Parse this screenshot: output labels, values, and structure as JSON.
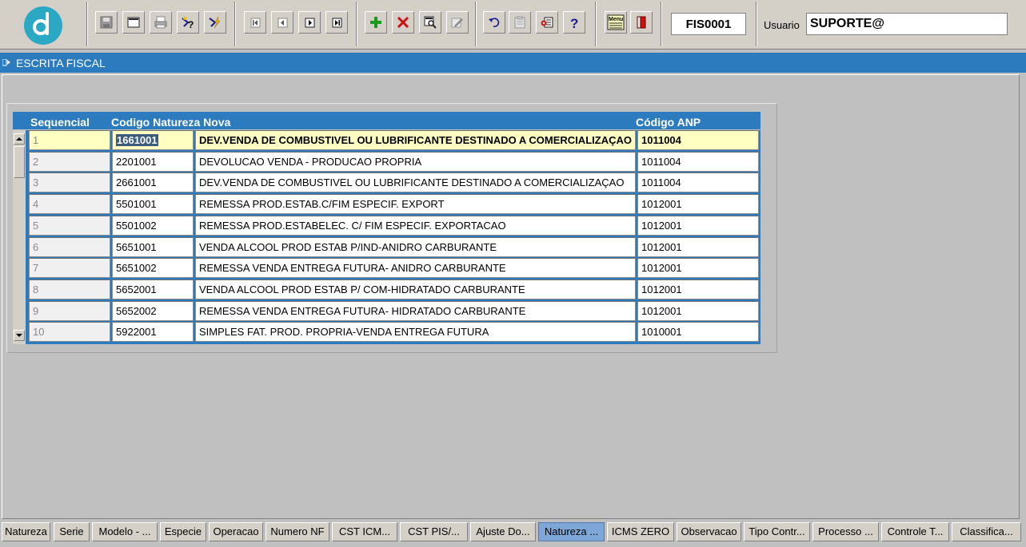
{
  "toolbar": {
    "form_code": "FIS0001",
    "user_label": "Usuario",
    "user_value": "SUPORTE@",
    "menu_icon_text": "Menu"
  },
  "window": {
    "title": "ESCRITA FISCAL"
  },
  "grid": {
    "columns": [
      "Sequencial",
      "Codigo Natureza Nova",
      "Código ANP"
    ],
    "rows": [
      {
        "seq": "1",
        "cod": "1661001",
        "desc": "DEV.VENDA DE COMBUSTIVEL OU LUBRIFICANTE DESTINADO A COMERCIALIZAÇAO",
        "anp": "1011004"
      },
      {
        "seq": "2",
        "cod": "2201001",
        "desc": "DEVOLUCAO VENDA - PRODUCAO PROPRIA",
        "anp": "1011004"
      },
      {
        "seq": "3",
        "cod": "2661001",
        "desc": "DEV.VENDA DE COMBUSTIVEL OU LUBRIFICANTE DESTINADO A COMERCIALIZAÇAO",
        "anp": "1011004"
      },
      {
        "seq": "4",
        "cod": "5501001",
        "desc": "REMESSA PROD.ESTAB.C/FIM ESPECIF. EXPORT",
        "anp": "1012001"
      },
      {
        "seq": "5",
        "cod": "5501002",
        "desc": "REMESSA PROD.ESTABELEC. C/ FIM ESPECIF. EXPORTACAO",
        "anp": "1012001"
      },
      {
        "seq": "6",
        "cod": "5651001",
        "desc": "VENDA ALCOOL PROD ESTAB P/IND-ANIDRO CARBURANTE",
        "anp": "1012001"
      },
      {
        "seq": "7",
        "cod": "5651002",
        "desc": "REMESSA VENDA ENTREGA FUTURA- ANIDRO CARBURANTE",
        "anp": "1012001"
      },
      {
        "seq": "8",
        "cod": "5652001",
        "desc": "VENDA ALCOOL PROD ESTAB P/ COM-HIDRATADO CARBURANTE",
        "anp": "1012001"
      },
      {
        "seq": "9",
        "cod": "5652002",
        "desc": "REMESSA VENDA ENTREGA FUTURA- HIDRATADO CARBURANTE",
        "anp": "1012001"
      },
      {
        "seq": "10",
        "cod": "5922001",
        "desc": "SIMPLES FAT. PROD. PROPRIA-VENDA ENTREGA FUTURA",
        "anp": "1010001"
      }
    ]
  },
  "tabs": [
    "Natureza",
    "Serie",
    "Modelo - ...",
    "Especie",
    "Operacao",
    "Numero NF",
    "CST ICM...",
    "CST PIS/...",
    "Ajuste Do...",
    "Natureza ...",
    "ICMS ZERO",
    "Observacao",
    "Tipo Contr...",
    "Processo ...",
    "Controle T...",
    "Classifica..."
  ],
  "active_tab_index": 9,
  "colors": {
    "accent": "#2d7bbf",
    "active_row": "#ffffc2",
    "active_tab": "#7ea7d8"
  }
}
